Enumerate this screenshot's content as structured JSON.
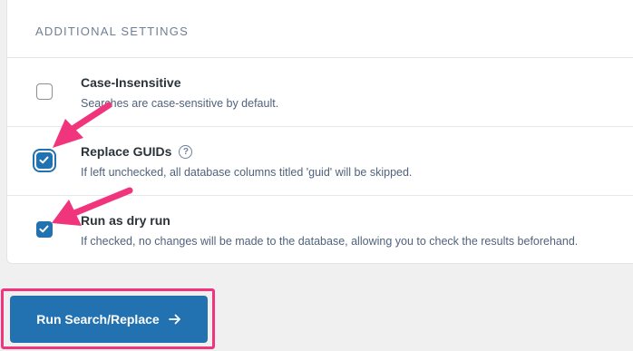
{
  "settings_section": {
    "title": "ADDITIONAL SETTINGS",
    "options": [
      {
        "label": "Case-Insensitive",
        "description": "Searches are case-sensitive by default.",
        "checked": false
      },
      {
        "label": "Replace GUIDs",
        "description": "If left unchecked, all database columns titled 'guid' will be skipped.",
        "checked": true,
        "help_icon": "question-circle-icon"
      },
      {
        "label": "Run as dry run",
        "description": "If checked, no changes will be made to the database, allowing you to check the results beforehand.",
        "checked": true
      }
    ]
  },
  "actions": {
    "run_button_label": "Run Search/Replace",
    "run_button_icon": "arrow-right-icon"
  },
  "colors": {
    "accent": "#2271b1",
    "annotation": "#f0357d"
  }
}
